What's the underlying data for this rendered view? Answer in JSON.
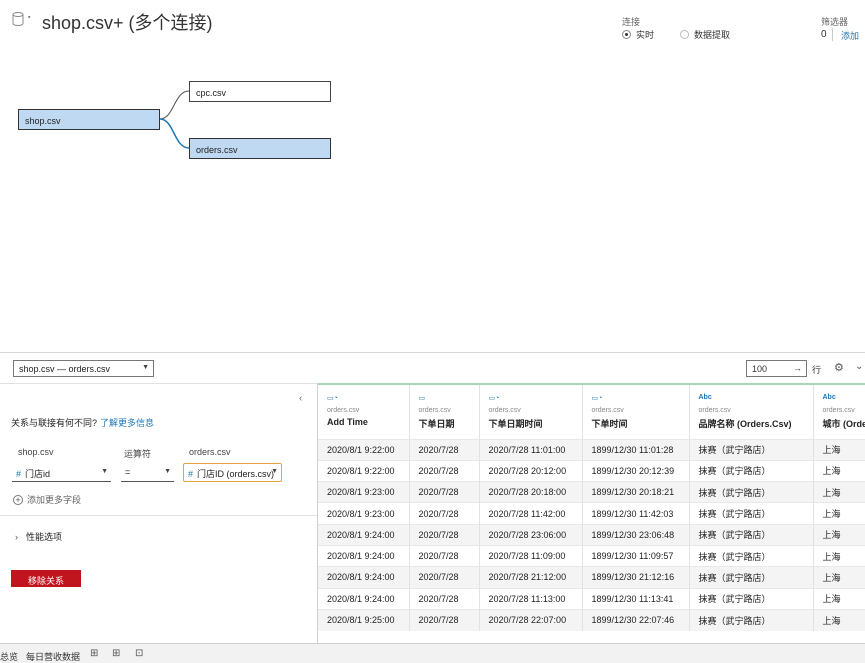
{
  "header": {
    "title": "shop.csv+ (多个连接)",
    "connection_label": "连接",
    "live_label": "实时",
    "extract_label": "数据提取",
    "filter_label": "筛选器",
    "filter_count": "0",
    "filter_add": "添加"
  },
  "canvas": {
    "left_table": "shop.csv",
    "top_table": "cpc.csv",
    "bottom_table": "orders.csv"
  },
  "toolbar": {
    "relation_select": "shop.csv — orders.csv",
    "rows_value": "100",
    "rows_label": "行"
  },
  "relation_panel": {
    "diff_question": "关系与联接有何不同?",
    "diff_link": "了解更多信息",
    "left_table_header": "shop.csv",
    "operator_header": "运算符",
    "right_table_header": "orders.csv",
    "left_field": "门店id",
    "operator": "=",
    "right_field": "门店ID (orders.csv)",
    "add_more_fields": "添加更多字段",
    "performance_options": "性能选项",
    "remove_relation": "移除关系"
  },
  "grid": {
    "columns": [
      {
        "icon": "calendar-time",
        "source": "orders.csv",
        "name": "Add Time"
      },
      {
        "icon": "calendar",
        "source": "orders.csv",
        "name": "下单日期"
      },
      {
        "icon": "calendar-time",
        "source": "orders.csv",
        "name": "下单日期时间"
      },
      {
        "icon": "calendar-time",
        "source": "orders.csv",
        "name": "下单时间"
      },
      {
        "icon": "Abc",
        "source": "orders.csv",
        "name": "品牌名称 (Orders.Csv)"
      },
      {
        "icon": "Abc",
        "source": "orders.csv",
        "name": "城市 (Orders.Csv)"
      }
    ],
    "rows": [
      [
        "2020/8/1 9:22:00",
        "2020/7/28",
        "2020/7/28 11:01:00",
        "1899/12/30 11:01:28",
        "抹赛（武宁路店）",
        "上海"
      ],
      [
        "2020/8/1 9:22:00",
        "2020/7/28",
        "2020/7/28 20:12:00",
        "1899/12/30 20:12:39",
        "抹赛（武宁路店）",
        "上海"
      ],
      [
        "2020/8/1 9:23:00",
        "2020/7/28",
        "2020/7/28 20:18:00",
        "1899/12/30 20:18:21",
        "抹赛（武宁路店）",
        "上海"
      ],
      [
        "2020/8/1 9:23:00",
        "2020/7/28",
        "2020/7/28 11:42:00",
        "1899/12/30 11:42:03",
        "抹赛（武宁路店）",
        "上海"
      ],
      [
        "2020/8/1 9:24:00",
        "2020/7/28",
        "2020/7/28 23:06:00",
        "1899/12/30 23:06:48",
        "抹赛（武宁路店）",
        "上海"
      ],
      [
        "2020/8/1 9:24:00",
        "2020/7/28",
        "2020/7/28 11:09:00",
        "1899/12/30 11:09:57",
        "抹赛（武宁路店）",
        "上海"
      ],
      [
        "2020/8/1 9:24:00",
        "2020/7/28",
        "2020/7/28 21:12:00",
        "1899/12/30 21:12:16",
        "抹赛（武宁路店）",
        "上海"
      ],
      [
        "2020/8/1 9:24:00",
        "2020/7/28",
        "2020/7/28 11:13:00",
        "1899/12/30 11:13:41",
        "抹赛（武宁路店）",
        "上海"
      ],
      [
        "2020/8/1 9:25:00",
        "2020/7/28",
        "2020/7/28 22:07:00",
        "1899/12/30 22:07:46",
        "抹赛（武宁路店）",
        "上海"
      ]
    ]
  },
  "bottom_tabs": {
    "tab1": "总览",
    "tab2": "每日营收数据"
  }
}
